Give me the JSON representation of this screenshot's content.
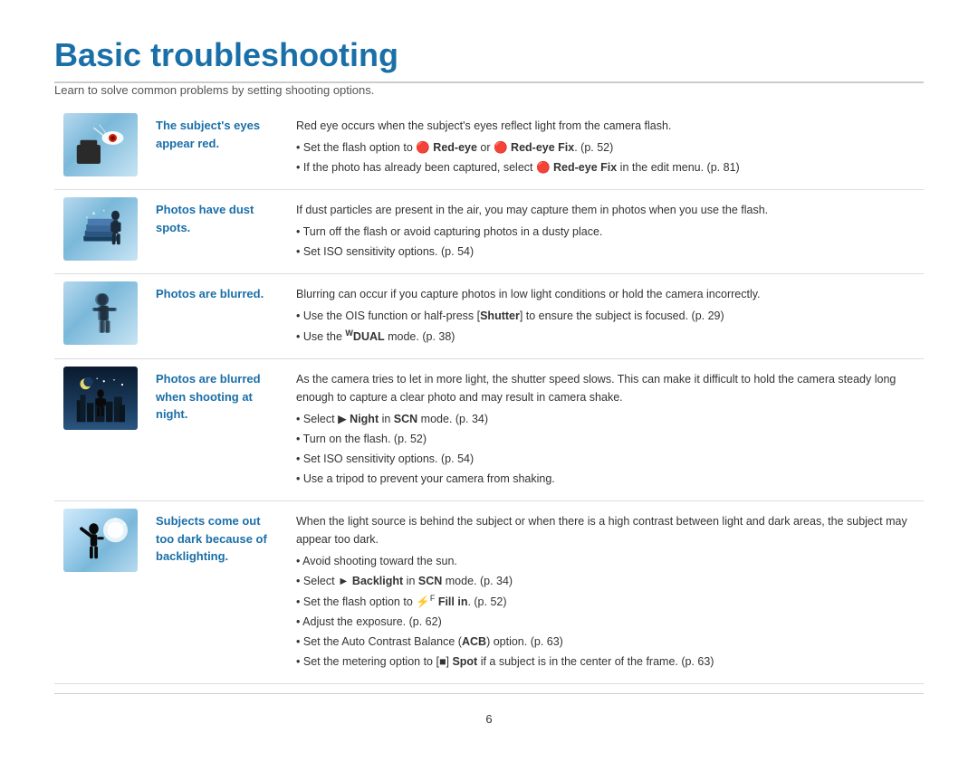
{
  "page": {
    "title": "Basic troubleshooting",
    "subtitle": "Learn to solve common problems by setting shooting options.",
    "page_number": "6"
  },
  "rows": [
    {
      "id": "red-eye",
      "label_line1": "The subject's eyes",
      "label_line2": "appear red.",
      "description_intro": "Red eye occurs when the subject's eyes reflect light from the camera flash.",
      "bullets": [
        "Set the flash option to  Red-eye or  Red-eye Fix. (p. 52)",
        "If the photo has already been captured, select  Red-eye Fix in the edit menu. (p. 81)"
      ]
    },
    {
      "id": "dust",
      "label_line1": "Photos have dust",
      "label_line2": "spots.",
      "description_intro": "If dust particles are present in the air, you may capture them in photos when you use the flash.",
      "bullets": [
        "Turn off the flash or avoid capturing photos in a dusty place.",
        "Set ISO sensitivity options. (p. 54)"
      ]
    },
    {
      "id": "blurred",
      "label_line1": "Photos are blurred.",
      "label_line2": "",
      "description_intro": "Blurring can occur if you capture photos in low light conditions or hold the camera incorrectly.",
      "bullets": [
        "Use the OIS function or half-press [Shutter] to ensure the subject is focused. (p. 29)",
        "Use the DUAL mode. (p. 38)"
      ]
    },
    {
      "id": "night",
      "label_line1": "Photos are blurred",
      "label_line2": "when shooting at",
      "label_line3": "night.",
      "description_intro": "As the camera tries to let in more light, the shutter speed slows. This can make it difficult to hold the camera steady long enough to capture a clear photo and may result in camera shake.",
      "bullets": [
        "Select  Night in SCN mode. (p. 34)",
        "Turn on the flash. (p. 52)",
        "Set ISO sensitivity options. (p. 54)",
        "Use a tripod to prevent your camera from shaking."
      ]
    },
    {
      "id": "backlight",
      "label_line1": "Subjects come out",
      "label_line2": "too dark because of",
      "label_line3": "backlighting.",
      "description_intro": "When the light source is behind the subject or when there is a high contrast between light and dark areas, the subject may appear too dark.",
      "bullets": [
        "Avoid shooting toward the sun.",
        "Select  Backlight in SCN mode. (p. 34)",
        "Set the flash option to  Fill in. (p. 52)",
        "Adjust the exposure. (p. 62)",
        "Set the Auto Contrast Balance (ACB) option. (p. 63)",
        "Set the metering option to  Spot if a subject is in the center of the frame. (p. 63)"
      ]
    }
  ]
}
